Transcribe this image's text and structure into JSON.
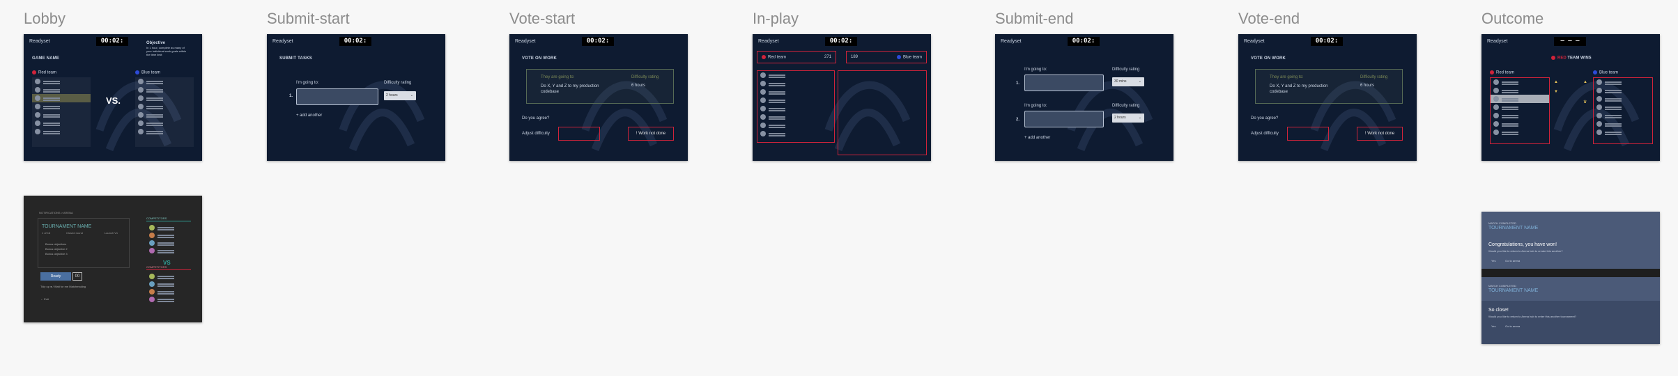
{
  "frames": [
    {
      "title": "Lobby"
    },
    {
      "title": "Submit-start"
    },
    {
      "title": "Vote-start"
    },
    {
      "title": "In-play"
    },
    {
      "title": "Submit-end"
    },
    {
      "title": "Vote-end"
    },
    {
      "title": "Outcome"
    }
  ],
  "common": {
    "brand": "Readyset",
    "timer": "00:02:"
  },
  "lobby": {
    "game_name": "GAME NAME",
    "objective_title": "Objective",
    "objective_text": "In 1 hour, complete as many of your individual work goals within the time limit",
    "red_team": "Red team",
    "blue_team": "Blue team",
    "vs": "VS."
  },
  "submit": {
    "heading": "SUBMIT TASKS",
    "going_to": "I'm going to:",
    "difficulty": "Difficulty rating",
    "num1": "1.",
    "num2": "2.",
    "sel1": "2 hours",
    "add": "+ add another",
    "sel_end1": "30 mins",
    "sel_end2": "2 hours"
  },
  "vote": {
    "heading": "VOTE ON WORK",
    "col1": "They are going to:",
    "col2": "Difficulty rating",
    "task": "Do X, Y and Z to my production codebase",
    "hours": "6 hours",
    "agree": "Do you agree?",
    "adjust": "Adjust difficulty",
    "not_done": "! Work not done"
  },
  "inplay": {
    "red_score_label": "Red team",
    "red_score": "271",
    "blue_score": "189",
    "blue_score_label": "Blue team"
  },
  "outcome": {
    "placeholder": "— — —",
    "team_win": "TEAM WINS",
    "red": "RED",
    "red_team": "Red team",
    "blue_team": "Blue team"
  },
  "tournament": {
    "breadcrumb": "NOTIFICATIONS > ARENA",
    "name": "TOURNAMENT NAME",
    "fields": [
      "1 of 16",
      "Closed round",
      "Launch V1"
    ],
    "bullets": [
      "Bonus objectives",
      "Bonus objective 2",
      "Bonus objective 3"
    ],
    "button": "Ready",
    "count": "00",
    "hint": "Tidy up ● / Wait for me Matchmaking",
    "exit": "← Exit",
    "vs": "VS",
    "team1": "COMPETITORS",
    "team2": "COMPETITORS"
  },
  "completed": {
    "label": "MATCH COMPLETED",
    "name": "TOURNAMENT NAME",
    "congrats": "Congratulations, you have won!",
    "question": "Would you like to return to Arena hub to create this another?",
    "yes": "Yes",
    "no": "Go to arena",
    "label2": "MATCH COMPLETED",
    "name2": "TOURNAMENT NAME",
    "so_close": "So close!",
    "question2": "Would you like to return to Arena hub to enter this another tournament?",
    "yes2": "Yes",
    "no2": "Go to arena"
  },
  "colors": {
    "bg": "#f7f7f7",
    "frame": "#0e1b31",
    "red": "#d0233a",
    "blue": "#2d4bd8",
    "dark": "#262626",
    "completed": "#4b5a78"
  }
}
